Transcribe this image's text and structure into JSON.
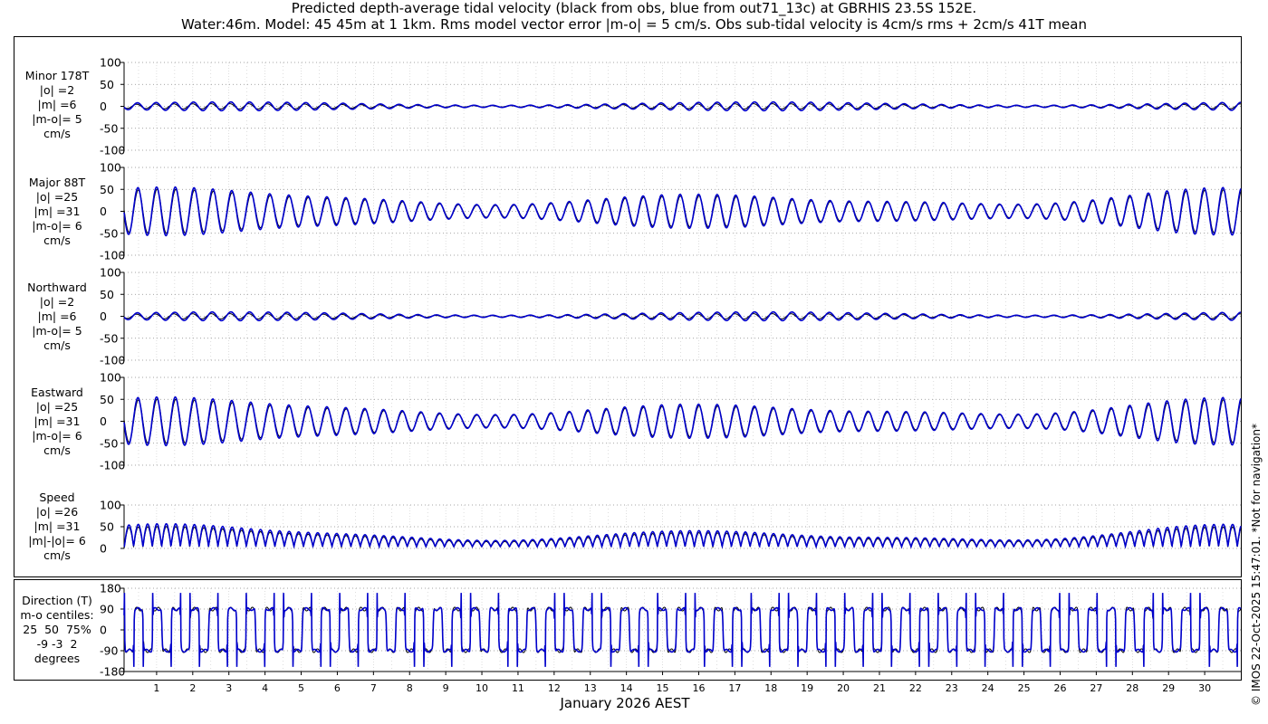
{
  "title_line1": "Predicted depth-average tidal velocity (black from obs, blue from out71_13c) at GBRHIS 23.5S 152E.",
  "title_line2": "Water:46m. Model: 45 45m at 1 1km. Rms model vector error |m-o| = 5 cm/s. Obs sub-tidal velocity is 4cm/s rms + 2cm/s 41T mean",
  "xlabel": "January 2026 AEST",
  "credit": "© IMOS 22-Oct-2025 15:47:01. *Not for navigation*",
  "colors": {
    "obs": "#000000",
    "model": "#0000cc",
    "grid": "#888888"
  },
  "chart_data": [
    {
      "type": "line",
      "panel": "minor",
      "label_lines": [
        "Minor 178T",
        "|o| =2",
        "|m| =6",
        "|m-o|= 5",
        "cm/s"
      ],
      "ylim": [
        -100,
        100
      ],
      "yticks": [
        -100,
        -50,
        0,
        50,
        100
      ],
      "amplitude": {
        "obs": 6,
        "model": 10
      }
    },
    {
      "type": "line",
      "panel": "major",
      "label_lines": [
        "Major 88T",
        "|o| =25",
        "|m| =31",
        "|m-o|= 6",
        "cm/s"
      ],
      "ylim": [
        -100,
        100
      ],
      "yticks": [
        -100,
        -50,
        0,
        50,
        100
      ],
      "amplitude": {
        "obs": 45,
        "model": 50
      }
    },
    {
      "type": "line",
      "panel": "northward",
      "label_lines": [
        "Northward",
        "|o| =2",
        "|m| =6",
        "|m-o|= 5",
        "cm/s"
      ],
      "ylim": [
        -100,
        100
      ],
      "yticks": [
        -100,
        -50,
        0,
        50,
        100
      ],
      "amplitude": {
        "obs": 6,
        "model": 10
      }
    },
    {
      "type": "line",
      "panel": "eastward",
      "label_lines": [
        "Eastward",
        "|o| =25",
        "|m| =31",
        "|m-o|= 6",
        "cm/s"
      ],
      "ylim": [
        -100,
        100
      ],
      "yticks": [
        -100,
        -50,
        0,
        50,
        100
      ],
      "amplitude": {
        "obs": 45,
        "model": 50
      }
    },
    {
      "type": "line",
      "panel": "speed",
      "label_lines": [
        "Speed",
        "|o| =26",
        "|m| =31",
        "|m|-|o|= 6",
        "cm/s"
      ],
      "ylim": [
        0,
        100
      ],
      "yticks": [
        0,
        50,
        100
      ],
      "amplitude": {
        "obs": 45,
        "model": 50
      }
    },
    {
      "type": "line",
      "panel": "direction",
      "label_lines": [
        "Direction (T)",
        "m-o centiles:",
        "25  50  75%",
        "-9 -3  2",
        "degrees"
      ],
      "ylim": [
        -180,
        180
      ],
      "yticks": [
        -180,
        -90,
        0,
        90,
        180
      ],
      "ytick_labels": [
        "-180",
        "-90",
        "0",
        "90",
        "180"
      ]
    }
  ],
  "x_axis": {
    "day_labels": [
      "1",
      "2",
      "3",
      "4",
      "5",
      "6",
      "7",
      "8",
      "9",
      "10",
      "11",
      "12",
      "13",
      "14",
      "15",
      "16",
      "17",
      "18",
      "19",
      "20",
      "21",
      "22",
      "23",
      "24",
      "25",
      "26",
      "27",
      "28",
      "29",
      "30"
    ],
    "xlim_days": [
      0.1,
      31.0
    ]
  }
}
